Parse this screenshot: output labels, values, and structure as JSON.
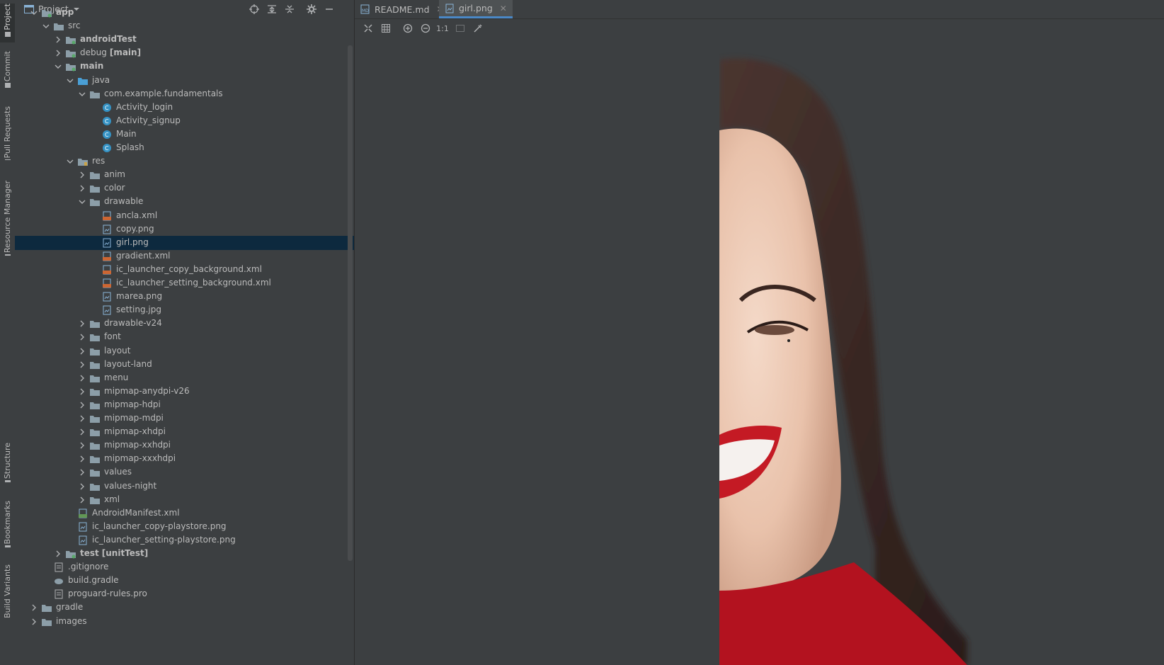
{
  "tool_strip": [
    {
      "label": "Project",
      "icon": "folder-icon",
      "active": true
    },
    {
      "label": "Commit",
      "icon": "commit-icon"
    },
    {
      "label": "Pull Requests",
      "icon": "pull-request-icon"
    },
    {
      "label": "Resource Manager",
      "icon": "resource-manager-icon"
    },
    {
      "label": "Structure",
      "icon": "structure-icon"
    },
    {
      "label": "Bookmarks",
      "icon": "bookmark-icon"
    },
    {
      "label": "Build Variants",
      "icon": "build-variants-icon"
    }
  ],
  "project": {
    "title": "Project",
    "header_actions": [
      "locate-icon",
      "expand-all-icon",
      "collapse-all-icon",
      "gear-icon",
      "minimize-icon"
    ]
  },
  "tree": [
    {
      "label": "app",
      "bold": true,
      "expanded": true,
      "icon": "module-folder-icon"
    },
    {
      "label": "src",
      "expanded": true,
      "icon": "folder-icon"
    },
    {
      "label": "androidTest",
      "bold": true,
      "collapsed": true,
      "icon": "source-folder-icon"
    },
    {
      "label": "debug",
      "suffix": "[main]",
      "collapsed": true,
      "icon": "source-folder-icon"
    },
    {
      "label": "main",
      "bold": true,
      "expanded": true,
      "icon": "source-folder-icon"
    },
    {
      "label": "java",
      "expanded": true,
      "icon": "java-folder-icon"
    },
    {
      "label": "com.example.fundamentals",
      "expanded": true,
      "icon": "package-icon"
    },
    {
      "label": "Activity_login",
      "icon": "class-icon"
    },
    {
      "label": "Activity_signup",
      "icon": "class-icon"
    },
    {
      "label": "Main",
      "icon": "class-icon"
    },
    {
      "label": "Splash",
      "icon": "class-icon"
    },
    {
      "label": "res",
      "expanded": true,
      "icon": "res-folder-icon"
    },
    {
      "label": "anim",
      "collapsed": true,
      "icon": "folder-icon"
    },
    {
      "label": "color",
      "collapsed": true,
      "icon": "folder-icon"
    },
    {
      "label": "drawable",
      "expanded": true,
      "icon": "folder-icon"
    },
    {
      "label": "ancla.xml",
      "icon": "xml-file-icon"
    },
    {
      "label": "copy.png",
      "icon": "image-file-icon"
    },
    {
      "label": "girl.png",
      "icon": "image-file-icon",
      "selected": true
    },
    {
      "label": "gradient.xml",
      "icon": "xml-file-icon"
    },
    {
      "label": "ic_launcher_copy_background.xml",
      "icon": "xml-file-icon"
    },
    {
      "label": "ic_launcher_setting_background.xml",
      "icon": "xml-file-icon"
    },
    {
      "label": "marea.png",
      "icon": "image-file-icon"
    },
    {
      "label": "setting.jpg",
      "icon": "image-file-icon"
    },
    {
      "label": "drawable-v24",
      "collapsed": true,
      "icon": "folder-icon"
    },
    {
      "label": "font",
      "collapsed": true,
      "icon": "folder-icon"
    },
    {
      "label": "layout",
      "collapsed": true,
      "icon": "folder-icon"
    },
    {
      "label": "layout-land",
      "collapsed": true,
      "icon": "folder-icon"
    },
    {
      "label": "menu",
      "collapsed": true,
      "icon": "folder-icon"
    },
    {
      "label": "mipmap-anydpi-v26",
      "collapsed": true,
      "icon": "folder-icon"
    },
    {
      "label": "mipmap-hdpi",
      "collapsed": true,
      "icon": "folder-icon"
    },
    {
      "label": "mipmap-mdpi",
      "collapsed": true,
      "icon": "folder-icon"
    },
    {
      "label": "mipmap-xhdpi",
      "collapsed": true,
      "icon": "folder-icon"
    },
    {
      "label": "mipmap-xxhdpi",
      "collapsed": true,
      "icon": "folder-icon"
    },
    {
      "label": "mipmap-xxxhdpi",
      "collapsed": true,
      "icon": "folder-icon"
    },
    {
      "label": "values",
      "collapsed": true,
      "icon": "folder-icon"
    },
    {
      "label": "values-night",
      "collapsed": true,
      "icon": "folder-icon"
    },
    {
      "label": "xml",
      "collapsed": true,
      "icon": "folder-icon"
    },
    {
      "label": "AndroidManifest.xml",
      "icon": "manifest-file-icon"
    },
    {
      "label": "ic_launcher_copy-playstore.png",
      "icon": "image-file-icon"
    },
    {
      "label": "ic_launcher_setting-playstore.png",
      "icon": "image-file-icon"
    },
    {
      "label": "test",
      "suffix": "[unitTest]",
      "bold": true,
      "collapsed": true,
      "icon": "source-folder-icon"
    },
    {
      "label": ".gitignore",
      "icon": "gitignore-file-icon"
    },
    {
      "label": "build.gradle",
      "icon": "gradle-file-icon"
    },
    {
      "label": "proguard-rules.pro",
      "icon": "text-file-icon"
    },
    {
      "label": "gradle",
      "collapsed": true,
      "icon": "folder-icon"
    },
    {
      "label": "images",
      "collapsed": true,
      "icon": "folder-icon"
    }
  ],
  "editor": {
    "tabs": [
      {
        "label": "README.md",
        "icon": "markdown-file-icon",
        "active": false
      },
      {
        "label": "girl.png",
        "icon": "image-file-icon",
        "active": true
      }
    ],
    "toolbar": [
      {
        "name": "fit-zoom-icon",
        "glyph": ""
      },
      {
        "name": "grid-icon",
        "glyph": ""
      },
      {
        "name": "zoom-in-icon",
        "glyph": ""
      },
      {
        "name": "zoom-out-icon",
        "glyph": ""
      },
      {
        "name": "actual-size-button",
        "glyph": "1:1"
      },
      {
        "name": "chessboard-icon",
        "glyph": ""
      },
      {
        "name": "color-picker-icon",
        "glyph": ""
      }
    ],
    "image": {
      "name": "girl.png"
    }
  }
}
